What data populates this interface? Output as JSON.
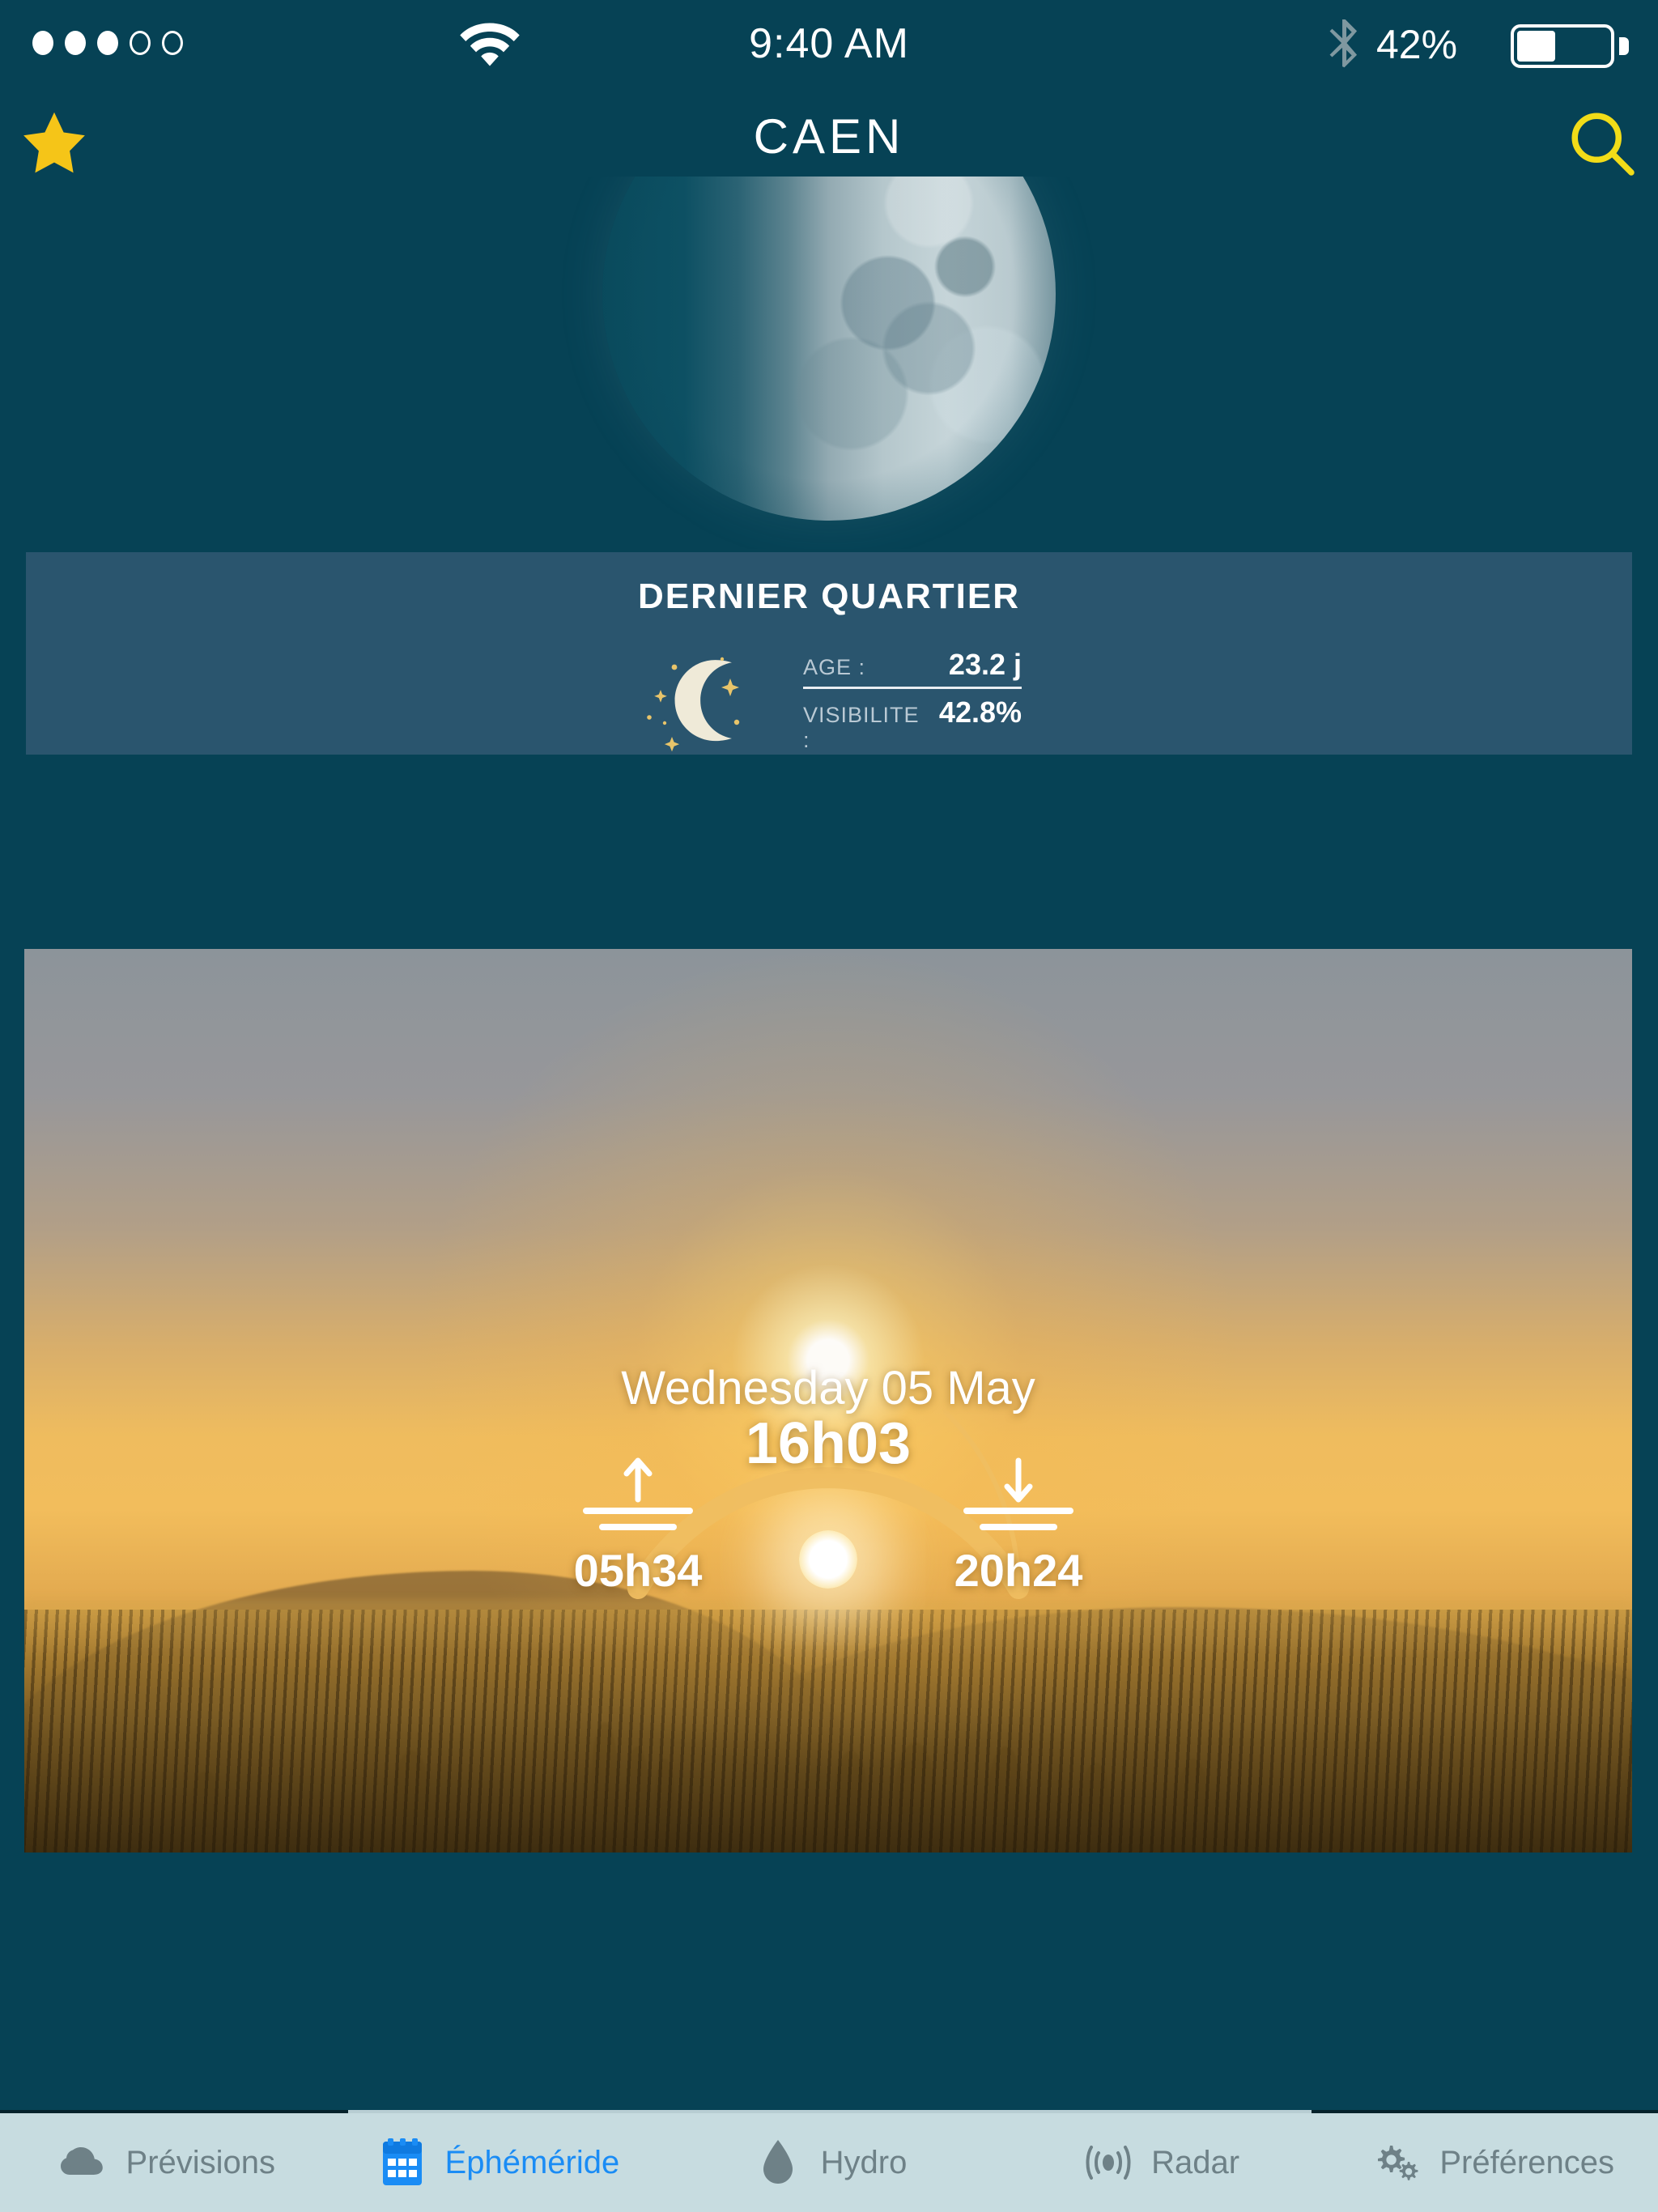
{
  "status_bar": {
    "signal_dots": [
      true,
      true,
      true,
      false,
      false
    ],
    "wifi_icon": "wifi-icon",
    "time": "9:40 AM",
    "bluetooth_icon": "bluetooth-icon",
    "battery_percent": "42%",
    "battery_level": 42
  },
  "nav_bar": {
    "favorite_icon": "star-icon",
    "title": "CAEN",
    "search_icon": "search-icon"
  },
  "moon": {
    "photo_alt": "moon-photo",
    "phase_name": "DERNIER QUARTIER",
    "icon": "crescent-moon-icon",
    "age_label": "AGE :",
    "age_value": "23.2 j",
    "visibility_label": "VISIBILITE :",
    "visibility_value": "42.8%"
  },
  "sun": {
    "photo_alt": "sunset-landscape-photo",
    "date": "Wednesday 05 May",
    "current_time": "16h03",
    "sunrise_icon": "sunrise-arrow-up-icon",
    "sunrise_time": "05h34",
    "sunset_icon": "sunset-arrow-down-icon",
    "sunset_time": "20h24"
  },
  "tab_bar": {
    "items": [
      {
        "label": "Prévisions",
        "icon": "cloud-icon",
        "active": false
      },
      {
        "label": "Éphéméride",
        "icon": "calendar-icon",
        "active": true
      },
      {
        "label": "Hydro",
        "icon": "droplet-icon",
        "active": false
      },
      {
        "label": "Radar",
        "icon": "radar-icon",
        "active": false
      },
      {
        "label": "Préférences",
        "icon": "gears-icon",
        "active": false
      }
    ]
  },
  "colors": {
    "background": "#064255",
    "panel": "#2a556e",
    "accent_yellow": "#f5c518",
    "tab_active": "#1a8cf5",
    "tab_inactive": "#6e8187",
    "tab_bar_bg": "#c7dce0",
    "arc": "#efbe61"
  }
}
